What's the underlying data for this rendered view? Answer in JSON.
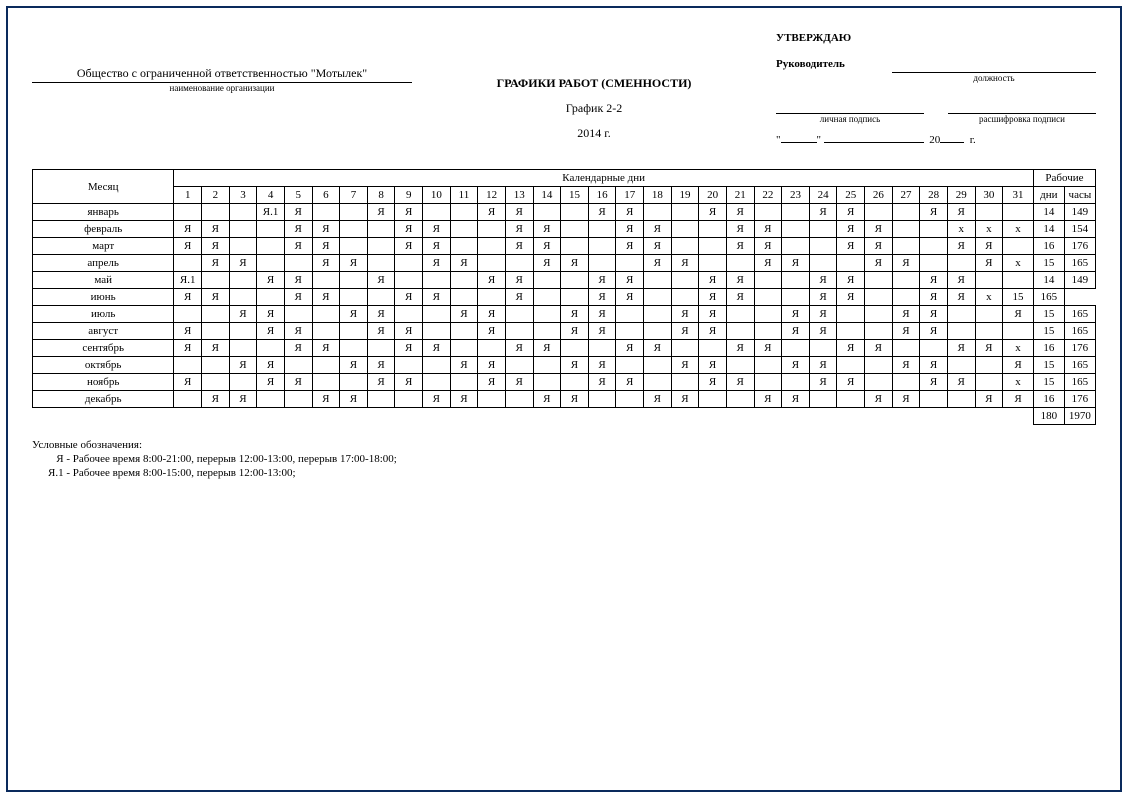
{
  "header": {
    "organization": "Общество с ограниченной ответственностью \"Мотылек\"",
    "org_caption": "наименование организации",
    "title1": "ГРАФИКИ РАБОТ (СМЕННОСТИ)",
    "title2": "График 2-2",
    "title3": "2014 г.",
    "approve": "УТВЕРЖДАЮ",
    "manager": "Руководитель",
    "position_label": "должность",
    "signature_label": "личная подпись",
    "signature_decode_label": "расшифровка подписи",
    "quote_open": "\"",
    "quote_close": "\"",
    "year_prefix": "20",
    "year_suffix": "г."
  },
  "table": {
    "month_header": "Месяц",
    "calendar_header": "Календарные дни",
    "work_header": "Рабочие",
    "days_label": "дни",
    "hours_label": "часы",
    "day_numbers": [
      "1",
      "2",
      "3",
      "4",
      "5",
      "6",
      "7",
      "8",
      "9",
      "10",
      "11",
      "12",
      "13",
      "14",
      "15",
      "16",
      "17",
      "18",
      "19",
      "20",
      "21",
      "22",
      "23",
      "24",
      "25",
      "26",
      "27",
      "28",
      "29",
      "30",
      "31"
    ],
    "rows": [
      {
        "month": "январь",
        "cells": [
          "",
          "",
          "",
          "Я.1",
          "Я",
          "",
          "",
          "Я",
          "Я",
          "",
          "",
          "Я",
          "Я",
          "",
          "",
          "Я",
          "Я",
          "",
          "",
          "Я",
          "Я",
          "",
          "",
          "Я",
          "Я",
          "",
          "",
          "Я",
          "Я",
          "",
          ""
        ],
        "days": "14",
        "hours": "149"
      },
      {
        "month": "февраль",
        "cells": [
          "Я",
          "Я",
          "",
          "",
          "Я",
          "Я",
          "",
          "",
          "Я",
          "Я",
          "",
          "",
          "Я",
          "Я",
          "",
          "",
          "Я",
          "Я",
          "",
          "",
          "Я",
          "Я",
          "",
          "",
          "Я",
          "Я",
          "",
          "",
          "х",
          "х",
          "х"
        ],
        "days": "14",
        "hours": "154"
      },
      {
        "month": "март",
        "cells": [
          "Я",
          "Я",
          "",
          "",
          "Я",
          "Я",
          "",
          "",
          "Я",
          "Я",
          "",
          "",
          "Я",
          "Я",
          "",
          "",
          "Я",
          "Я",
          "",
          "",
          "Я",
          "Я",
          "",
          "",
          "Я",
          "Я",
          "",
          "",
          "Я",
          "Я",
          ""
        ],
        "days": "16",
        "hours": "176"
      },
      {
        "month": "апрель",
        "cells": [
          "",
          "Я",
          "Я",
          "",
          "",
          "Я",
          "Я",
          "",
          "",
          "Я",
          "Я",
          "",
          "",
          "Я",
          "Я",
          "",
          "",
          "Я",
          "Я",
          "",
          "",
          "Я",
          "Я",
          "",
          "",
          "Я",
          "Я",
          "",
          "",
          "Я",
          "х"
        ],
        "days": "15",
        "hours": "165"
      },
      {
        "month": "май",
        "cells": [
          "Я.1",
          "",
          "",
          "Я",
          "Я",
          "",
          "",
          "Я",
          "",
          "",
          "",
          "Я",
          "Я",
          "",
          "",
          "Я",
          "Я",
          "",
          "",
          "Я",
          "Я",
          "",
          "",
          "Я",
          "Я",
          "",
          "",
          "Я",
          "Я",
          "",
          ""
        ],
        "days": "14",
        "hours": "149"
      },
      {
        "month": "июнь",
        "cells": [
          "Я",
          "Я",
          "",
          "",
          "Я",
          "Я",
          "",
          "",
          "Я",
          "Я",
          "",
          "",
          "Я",
          "",
          "",
          "Я",
          "Я",
          "",
          "",
          "Я",
          "Я",
          "",
          "",
          "Я",
          "Я",
          "",
          "",
          "Я",
          "Я",
          "х"
        ],
        "days": "15",
        "hours": "165"
      },
      {
        "month": "июль",
        "cells": [
          "",
          "",
          "Я",
          "Я",
          "",
          "",
          "Я",
          "Я",
          "",
          "",
          "Я",
          "Я",
          "",
          "",
          "Я",
          "Я",
          "",
          "",
          "Я",
          "Я",
          "",
          "",
          "Я",
          "Я",
          "",
          "",
          "Я",
          "Я",
          "",
          "",
          "Я"
        ],
        "days": "15",
        "hours": "165"
      },
      {
        "month": "август",
        "cells": [
          "Я",
          "",
          "",
          "Я",
          "Я",
          "",
          "",
          "Я",
          "Я",
          "",
          "",
          "Я",
          "",
          "",
          "Я",
          "Я",
          "",
          "",
          "Я",
          "Я",
          "",
          "",
          "Я",
          "Я",
          "",
          "",
          "Я",
          "Я",
          "",
          "",
          ""
        ],
        "days": "15",
        "hours": "165"
      },
      {
        "month": "сентябрь",
        "cells": [
          "Я",
          "Я",
          "",
          "",
          "Я",
          "Я",
          "",
          "",
          "Я",
          "Я",
          "",
          "",
          "Я",
          "Я",
          "",
          "",
          "Я",
          "Я",
          "",
          "",
          "Я",
          "Я",
          "",
          "",
          "Я",
          "Я",
          "",
          "",
          "Я",
          "Я",
          "х"
        ],
        "days": "16",
        "hours": "176"
      },
      {
        "month": "октябрь",
        "cells": [
          "",
          "",
          "Я",
          "Я",
          "",
          "",
          "Я",
          "Я",
          "",
          "",
          "Я",
          "Я",
          "",
          "",
          "Я",
          "Я",
          "",
          "",
          "Я",
          "Я",
          "",
          "",
          "Я",
          "Я",
          "",
          "",
          "Я",
          "Я",
          "",
          "",
          "Я"
        ],
        "days": "15",
        "hours": "165"
      },
      {
        "month": "ноябрь",
        "cells": [
          "Я",
          "",
          "",
          "Я",
          "Я",
          "",
          "",
          "Я",
          "Я",
          "",
          "",
          "Я",
          "Я",
          "",
          "",
          "Я",
          "Я",
          "",
          "",
          "Я",
          "Я",
          "",
          "",
          "Я",
          "Я",
          "",
          "",
          "Я",
          "Я",
          "",
          "х"
        ],
        "days": "15",
        "hours": "165"
      },
      {
        "month": "декабрь",
        "cells": [
          "",
          "Я",
          "Я",
          "",
          "",
          "Я",
          "Я",
          "",
          "",
          "Я",
          "Я",
          "",
          "",
          "Я",
          "Я",
          "",
          "",
          "Я",
          "Я",
          "",
          "",
          "Я",
          "Я",
          "",
          "",
          "Я",
          "Я",
          "",
          "",
          "Я",
          "Я"
        ],
        "days": "16",
        "hours": "176"
      }
    ],
    "total_days": "180",
    "total_hours": "1970"
  },
  "legend": {
    "title": "Условные обозначения:",
    "line1_code": "Я -",
    "line1_text": "Рабочее время 8:00-21:00, перерыв 12:00-13:00, перерыв 17:00-18:00;",
    "line2_code": "Я.1 -",
    "line2_text": "Рабочее время 8:00-15:00, перерыв 12:00-13:00;"
  }
}
